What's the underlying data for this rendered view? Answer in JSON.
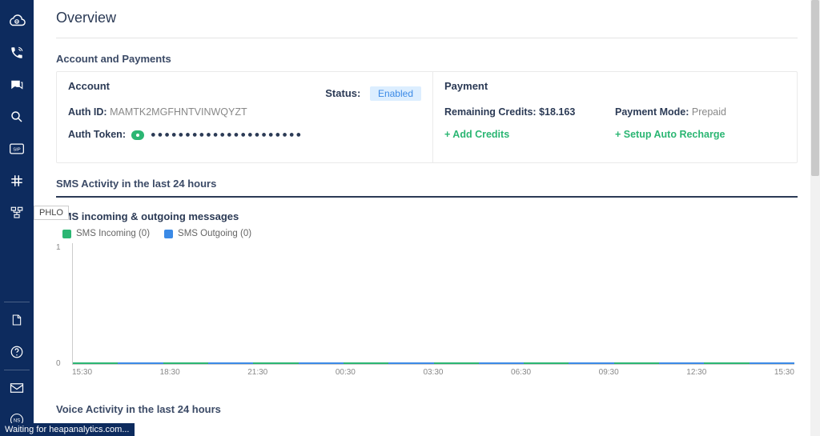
{
  "sidebar": {
    "tooltip": "PHLO"
  },
  "page": {
    "title": "Overview"
  },
  "account_section": {
    "title": "Account and Payments",
    "account_header": "Account",
    "status_label": "Status:",
    "status_value": "Enabled",
    "auth_id_label": "Auth ID:",
    "auth_id_value": "MAMTK2MGFHNTVINWQYZT",
    "auth_token_label": "Auth Token:",
    "auth_token_masked": "●●●●●●●●●●●●●●●●●●●●●●",
    "payment_header": "Payment",
    "remaining_credits_label": "Remaining Credits:",
    "remaining_credits_value": "$18.163",
    "payment_mode_label": "Payment Mode:",
    "payment_mode_value": "Prepaid",
    "add_credits": "+ Add Credits",
    "setup_auto": "+ Setup Auto Recharge"
  },
  "sms_activity": {
    "section_title": "SMS Activity in the last 24 hours",
    "chart_title": "SMS incoming & outgoing messages",
    "legend_in": "SMS Incoming (0)",
    "legend_out": "SMS Outgoing (0)"
  },
  "voice_activity": {
    "section_title": "Voice Activity in the last 24 hours"
  },
  "status_bar": "Waiting for heapanalytics.com...",
  "chart_data": {
    "type": "line",
    "title": "SMS incoming & outgoing messages",
    "xlabel": "",
    "ylabel": "",
    "ylim": [
      0,
      1
    ],
    "categories": [
      "15:30",
      "18:30",
      "21:30",
      "00:30",
      "03:30",
      "06:30",
      "09:30",
      "12:30",
      "15:30"
    ],
    "series": [
      {
        "name": "SMS Incoming",
        "values": [
          0,
          0,
          0,
          0,
          0,
          0,
          0,
          0,
          0
        ]
      },
      {
        "name": "SMS Outgoing",
        "values": [
          0,
          0,
          0,
          0,
          0,
          0,
          0,
          0,
          0
        ]
      }
    ]
  }
}
